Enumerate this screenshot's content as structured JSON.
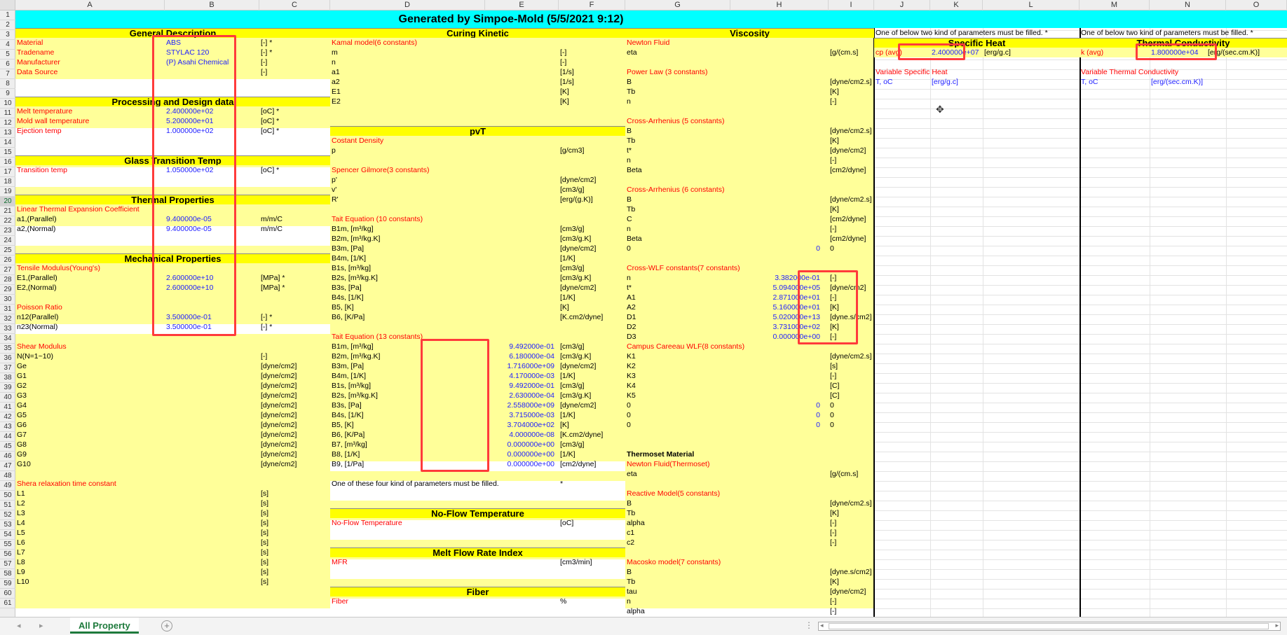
{
  "banner": "Generated by Simpoe-Mold (5/5/2021 9:12)",
  "columns": [
    "A",
    "B",
    "C",
    "D",
    "E",
    "F",
    "G",
    "H",
    "I",
    "J",
    "K",
    "L",
    "M",
    "N",
    "O"
  ],
  "rows": [
    "1",
    "2",
    "3",
    "4",
    "5",
    "6",
    "7",
    "8",
    "9",
    "10",
    "11",
    "12",
    "13",
    "14",
    "15",
    "16",
    "17",
    "18",
    "19",
    "20",
    "21",
    "22",
    "23",
    "24",
    "25",
    "26",
    "27",
    "28",
    "29",
    "30",
    "31",
    "32",
    "33",
    "34",
    "35",
    "36",
    "37",
    "38",
    "39",
    "40",
    "41",
    "42",
    "43",
    "44",
    "45",
    "46",
    "47",
    "48",
    "49",
    "50",
    "51",
    "52",
    "53",
    "54",
    "55",
    "56",
    "57",
    "58",
    "59",
    "60",
    "61"
  ],
  "general": {
    "header": "General Description",
    "rows": [
      {
        "label": "Material",
        "value": "ABS",
        "unit": "[-] *"
      },
      {
        "label": "Tradename",
        "value": "STYLAC 120",
        "unit": "[-] *"
      },
      {
        "label": "Manufacturer",
        "value": "(P)  Asahi Chemical",
        "unit": "[-]"
      },
      {
        "label": "Data Source",
        "value": "",
        "unit": "[-]"
      }
    ]
  },
  "processing": {
    "header": "Processing and Design data",
    "rows": [
      {
        "label": "Melt temperature",
        "value": "2.400000e+02",
        "unit": "[oC] *"
      },
      {
        "label": "Mold wall temperature",
        "value": "5.200000e+01",
        "unit": "[oC] *"
      },
      {
        "label": "Ejection temp",
        "value": "1.000000e+02",
        "unit": "[oC] *"
      }
    ]
  },
  "glass": {
    "header": "Glass Transition Temp",
    "rows": [
      {
        "label": "Transition temp",
        "value": "1.050000e+02",
        "unit": "[oC] *"
      }
    ]
  },
  "thermal": {
    "header": "Thermal Properties",
    "sub": "Linear Thermal Expansion Coefficient",
    "rows": [
      {
        "label": "a1,(Parallel)",
        "value": "9.400000e-05",
        "unit": "m/m/C"
      },
      {
        "label": "a2,(Normal)",
        "value": "9.400000e-05",
        "unit": "m/m/C"
      }
    ]
  },
  "mechanical": {
    "header": "Mechanical Properties",
    "tensile": "Tensile Modulus(Young's)",
    "tensile_rows": [
      {
        "label": "E1,(Parallel)",
        "value": "2.600000e+10",
        "unit": "[MPa] *"
      },
      {
        "label": "E2,(Normal)",
        "value": "2.600000e+10",
        "unit": "[MPa] *"
      }
    ],
    "poisson": "Poisson Ratio",
    "poisson_rows": [
      {
        "label": "n12(Parallel)",
        "value": "3.500000e-01",
        "unit": "[-] *"
      },
      {
        "label": "n23(Normal)",
        "value": "3.500000e-01",
        "unit": "[-] *"
      }
    ],
    "shear": "Shear Modulus",
    "shear_rows": [
      {
        "label": "N(N=1~10)",
        "unit": "[-]"
      },
      {
        "label": "Ge",
        "unit": "[dyne/cm2]"
      },
      {
        "label": "G1",
        "unit": "[dyne/cm2]"
      },
      {
        "label": "G2",
        "unit": "[dyne/cm2]"
      },
      {
        "label": "G3",
        "unit": "[dyne/cm2]"
      },
      {
        "label": "G4",
        "unit": "[dyne/cm2]"
      },
      {
        "label": "G5",
        "unit": "[dyne/cm2]"
      },
      {
        "label": "G6",
        "unit": "[dyne/cm2]"
      },
      {
        "label": "G7",
        "unit": "[dyne/cm2]"
      },
      {
        "label": "G8",
        "unit": "[dyne/cm2]"
      },
      {
        "label": "G9",
        "unit": "[dyne/cm2]"
      },
      {
        "label": "G10",
        "unit": "[dyne/cm2]"
      }
    ],
    "relax": "Shera relaxation time constant",
    "relax_rows": [
      {
        "label": "L1",
        "unit": "[s]"
      },
      {
        "label": "L2",
        "unit": "[s]"
      },
      {
        "label": "L3",
        "unit": "[s]"
      },
      {
        "label": "L4",
        "unit": "[s]"
      },
      {
        "label": "L5",
        "unit": "[s]"
      },
      {
        "label": "L6",
        "unit": "[s]"
      },
      {
        "label": "L7",
        "unit": "[s]"
      },
      {
        "label": "L8",
        "unit": "[s]"
      },
      {
        "label": "L9",
        "unit": "[s]"
      },
      {
        "label": "L10",
        "unit": "[s]"
      }
    ]
  },
  "curing": {
    "header": "Curing Kinetic",
    "sub": "Kamal model(6 constants)",
    "rows": [
      {
        "label": "m",
        "unit": "[-]"
      },
      {
        "label": "n",
        "unit": "[-]"
      },
      {
        "label": "a1",
        "unit": "[1/s]"
      },
      {
        "label": "a2",
        "unit": "[1/s]"
      },
      {
        "label": "E1",
        "unit": "[K]"
      },
      {
        "label": "E2",
        "unit": "[K]"
      }
    ]
  },
  "pvt": {
    "header": "pvT",
    "const_density": "Costant Density",
    "p_label": "p",
    "p_unit": "[g/cm3]",
    "spencer": "Spencer Gilmore(3 constants)",
    "spencer_rows": [
      {
        "label": "p'",
        "unit": "[dyne/cm2]"
      },
      {
        "label": "v'",
        "unit": "[cm3/g]"
      },
      {
        "label": "R'",
        "unit": "[erg/(g.K)]"
      }
    ],
    "tait10": "Tait Equation (10 constants)",
    "tait10_rows": [
      {
        "label": "B1m, [m³/kg]",
        "unit": "[cm3/g]"
      },
      {
        "label": "B2m, [m³/kg.K]",
        "unit": "[cm3/g.K]"
      },
      {
        "label": "B3m, [Pa]",
        "unit": "[dyne/cm2]"
      },
      {
        "label": "B4m, [1/K]",
        "unit": "[1/K]"
      },
      {
        "label": "B1s, [m³/kg]",
        "unit": "[cm3/g]"
      },
      {
        "label": "B2s, [m³/kg.K]",
        "unit": "[cm3/g.K]"
      },
      {
        "label": "B3s, [Pa]",
        "unit": "[dyne/cm2]"
      },
      {
        "label": "B4s, [1/K]",
        "unit": "[1/K]"
      },
      {
        "label": "B5, [K]",
        "unit": "[K]"
      },
      {
        "label": "B6, [K/Pa]",
        "unit": "[K.cm2/dyne]"
      }
    ],
    "tait13": "Tait Equation (13 constants)",
    "tait13_rows": [
      {
        "label": "B1m, [m³/kg]",
        "value": "9.492000e-01",
        "unit": "[cm3/g]"
      },
      {
        "label": "B2m, [m³/kg.K]",
        "value": "6.180000e-04",
        "unit": "[cm3/g.K]"
      },
      {
        "label": "B3m, [Pa]",
        "value": "1.716000e+09",
        "unit": "[dyne/cm2]"
      },
      {
        "label": "B4m, [1/K]",
        "value": "4.170000e-03",
        "unit": "[1/K]"
      },
      {
        "label": "B1s, [m³/kg]",
        "value": "9.492000e-01",
        "unit": "[cm3/g]"
      },
      {
        "label": "B2s, [m³/kg.K]",
        "value": "2.630000e-04",
        "unit": "[cm3/g.K]"
      },
      {
        "label": "B3s, [Pa]",
        "value": "2.558000e+09",
        "unit": "[dyne/cm2]"
      },
      {
        "label": "B4s, [1/K]",
        "value": "3.715000e-03",
        "unit": "[1/K]"
      },
      {
        "label": "B5, [K]",
        "value": "3.704000e+02",
        "unit": "[K]"
      },
      {
        "label": "B6, [K/Pa]",
        "value": "4.000000e-08",
        "unit": "[K.cm2/dyne]"
      },
      {
        "label": "B7, [m³/kg]",
        "value": "0.000000e+00",
        "unit": "[cm3/g]"
      },
      {
        "label": "B8, [1/K]",
        "value": "0.000000e+00",
        "unit": "[1/K]"
      },
      {
        "label": "B9, [1/Pa]",
        "value": "0.000000e+00",
        "unit": "[cm2/dyne]"
      }
    ],
    "note": "One of these four kind of parameters must be filled.",
    "note_star": "*"
  },
  "noflow": {
    "header": "No-Flow Temperature",
    "label": "No-Flow Temperature",
    "unit": "[oC]"
  },
  "mfr": {
    "header": "Melt Flow Rate Index",
    "label": "MFR",
    "unit": "[cm3/min]"
  },
  "fiber": {
    "header": "Fiber",
    "label": "Fiber",
    "unit": "%"
  },
  "viscosity": {
    "header": "Viscosity",
    "newton": "Newton Fluid",
    "newton_rows": [
      {
        "label": "eta",
        "unit": "[g/(cm.s]"
      }
    ],
    "power": "Power Law (3 constants)",
    "power_rows": [
      {
        "label": "B",
        "unit": "[dyne/cm2.s]"
      },
      {
        "label": "Tb",
        "unit": "[K]"
      },
      {
        "label": "n",
        "unit": "[-]"
      }
    ],
    "ca5": "Cross-Arrhenius (5 constants)",
    "ca5_rows": [
      {
        "label": "B",
        "unit": "[dyne/cm2.s]"
      },
      {
        "label": "Tb",
        "unit": "[K]"
      },
      {
        "label": "t*",
        "unit": "[dyne/cm2]"
      },
      {
        "label": "n",
        "unit": "[-]"
      },
      {
        "label": "Beta",
        "unit": "[cm2/dyne]"
      }
    ],
    "ca6": "Cross-Arrhenius (6 constants)",
    "ca6_rows": [
      {
        "label": "B",
        "unit": "[dyne/cm2.s]"
      },
      {
        "label": "Tb",
        "unit": "[K]"
      },
      {
        "label": "C",
        "unit": "[cm2/dyne]"
      },
      {
        "label": "n",
        "unit": "[-]"
      },
      {
        "label": "Beta",
        "unit": "[cm2/dyne]"
      },
      {
        "label": "0",
        "value": "0",
        "unit": "0"
      }
    ],
    "wlf": "Cross-WLF constants(7 constants)",
    "wlf_rows": [
      {
        "label": "n",
        "value": "3.382000e-01",
        "unit": "[-]"
      },
      {
        "label": "t*",
        "value": "5.094000e+05",
        "unit": "[dyne/cm2]"
      },
      {
        "label": "A1",
        "value": "2.871000e+01",
        "unit": "[-]"
      },
      {
        "label": "A2",
        "value": "5.160000e+01",
        "unit": "[K]"
      },
      {
        "label": "D1",
        "value": "5.020000e+13",
        "unit": "[dyne.s/cm2]"
      },
      {
        "label": "D2",
        "value": "3.731000e+02",
        "unit": "[K]"
      },
      {
        "label": "D3",
        "value": "0.000000e+00",
        "unit": "[-]"
      }
    ],
    "campus": "Campus Careeau WLF(8 constants)",
    "campus_rows": [
      {
        "label": "K1",
        "value": "",
        "unit": "[dyne/cm2.s]"
      },
      {
        "label": "K2",
        "value": "",
        "unit": "[s]"
      },
      {
        "label": "K3",
        "value": "",
        "unit": "[-]"
      },
      {
        "label": "K4",
        "value": "",
        "unit": "[C]"
      },
      {
        "label": "K5",
        "value": "",
        "unit": "[C]"
      },
      {
        "label": "0",
        "value": "0",
        "unit": "0"
      },
      {
        "label": "0",
        "value": "0",
        "unit": "0"
      },
      {
        "label": "0",
        "value": "0",
        "unit": "0"
      }
    ],
    "thermoset": "Thermoset Material",
    "newton_t": "Newton Fluid(Thermoset)",
    "newton_t_rows": [
      {
        "label": "eta",
        "unit": "[g/(cm.s]"
      }
    ],
    "reactive": "Reactive Model(5 constants)",
    "reactive_rows": [
      {
        "label": "B",
        "unit": "[dyne/cm2.s]"
      },
      {
        "label": "Tb",
        "unit": "[K]"
      },
      {
        "label": "alpha",
        "unit": "[-]"
      },
      {
        "label": "c1",
        "unit": "[-]"
      },
      {
        "label": "c2",
        "unit": "[-]"
      }
    ],
    "macosko": "Macosko model(7 constants)",
    "macosko_rows": [
      {
        "label": "B",
        "unit": "[dyne.s/cm2]"
      },
      {
        "label": "Tb",
        "unit": "[K]"
      },
      {
        "label": "tau",
        "unit": "[dyne/cm2]"
      },
      {
        "label": "n",
        "unit": "[-]"
      },
      {
        "label": "alpha",
        "unit": "[-]"
      }
    ]
  },
  "specific_heat": {
    "note": "One of below two kind of parameters must be filled. *",
    "header": "Specific Heat",
    "label": "cp (avg)",
    "value": "2.400000e+07",
    "unit": "[erg/g.c]",
    "var": "Variable Specific Heat",
    "var_col1": "T, oC",
    "var_col2": "[erg/g.c]"
  },
  "thermal_cond": {
    "note": "One of below two kind of parameters must be filled. *",
    "header": "Thermal Conductivity",
    "label": "k (avg)",
    "value": "1.800000e+04",
    "unit": "[erg/(sec.cm.K)]",
    "var": "Variable Thermal Conductivity",
    "var_col1": "T, oC",
    "var_col2": "[erg/(sec.cm.K)]"
  },
  "tabs": {
    "sheet": "All Property"
  },
  "colors": {
    "yellow_fill": "#ffff99",
    "header_yellow": "#ffff00",
    "banner_cyan": "#00ffff",
    "label_red": "#ff0000",
    "value_blue": "#2020ff",
    "highlight_red": "#ff3b3b",
    "tab_green": "#1e7a3c"
  }
}
